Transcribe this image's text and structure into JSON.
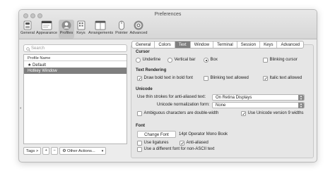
{
  "window": {
    "title": "Preferences"
  },
  "toolbar": {
    "items": [
      {
        "label": "General",
        "icon": "switch-icon"
      },
      {
        "label": "Appearance",
        "icon": "appearance-icon"
      },
      {
        "label": "Profiles",
        "icon": "person-icon"
      },
      {
        "label": "Keys",
        "icon": "keyboard-icon"
      },
      {
        "label": "Arrangements",
        "icon": "arrangements-icon"
      },
      {
        "label": "Pointer",
        "icon": "mouse-icon"
      },
      {
        "label": "Advanced",
        "icon": "gear-icon"
      }
    ],
    "selected": "Profiles"
  },
  "sidebar": {
    "search_placeholder": "Search",
    "list_header": "Profile Name",
    "profiles": [
      {
        "label": "★ Default"
      },
      {
        "label": "Hotkey Window"
      }
    ],
    "selected_profile": "Hotkey Window",
    "tags_label": "Tags >",
    "add_label": "+",
    "remove_label": "−",
    "other_actions_label": "⚙ Other Actions..."
  },
  "tabs": {
    "items": [
      "General",
      "Colors",
      "Text",
      "Window",
      "Terminal",
      "Session",
      "Keys",
      "Advanced"
    ],
    "selected": "Text"
  },
  "cursor": {
    "heading": "Cursor",
    "underline": "Underline",
    "vertical_bar": "Vertical bar",
    "box": "Box",
    "blinking": "Blinking cursor"
  },
  "text_rendering": {
    "heading": "Text Rendering",
    "bold": "Draw bold text in bold font",
    "blinking_text": "Blinking text allowed",
    "italic": "Italic text allowed"
  },
  "unicode": {
    "heading": "Unicode",
    "thin_strokes_label": "Use thin strokes for anti-aliased text:",
    "thin_strokes_value": "On Retina Displays",
    "normalization_label": "Unicode normalization form:",
    "normalization_value": "None",
    "ambiguous": "Ambiguous characters are double-width",
    "unicode_9": "Use Unicode version 9 widths"
  },
  "font": {
    "heading": "Font",
    "change_font": "Change Font",
    "font_name": "14pt Operator Mono Book",
    "ligatures": "Use ligatures",
    "anti_aliased": "Anti-aliased",
    "non_ascii": "Use a different font for non-ASCII text"
  },
  "colors": {
    "selected_bg": "#7f7f7f",
    "window_bg": "#ececec"
  }
}
